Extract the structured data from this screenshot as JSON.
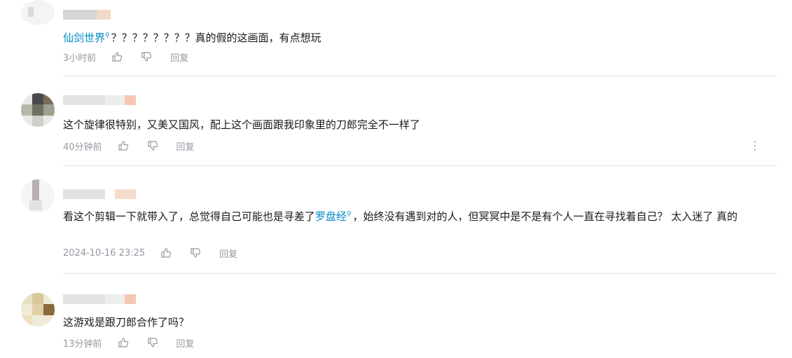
{
  "comments": [
    {
      "text_parts": {
        "keyword": "仙剑世界",
        "rest": "？？？？？？？？真的假的这画面，有点想玩"
      },
      "time": "3小时前",
      "reply_label": "回复"
    },
    {
      "text": "这个旋律很特别，又美又国风，配上这个画面跟我印象里的刀郎完全不一样了",
      "time": "40分钟前",
      "reply_label": "回复",
      "more_icon": "⋮"
    },
    {
      "text_parts": {
        "before": "看这个剪辑一下就带入了，总觉得自己可能也是寻差了",
        "keyword": "罗盘经",
        "after": "，始终没有遇到对的人，但冥冥中是不是有个人一直在寻找着自己？ 太入迷了 真的"
      },
      "time": "2024-10-16 23:25",
      "reply_label": "回复"
    },
    {
      "text": "这游戏是跟刀郎合作了吗？",
      "time": "13分钟前",
      "reply_label": "回复"
    }
  ],
  "colors": {
    "keyword": "#008ac5",
    "meta": "#9499a0",
    "divider": "#e3e5e7"
  },
  "icons": {
    "like": "thumbs-up-icon",
    "dislike": "thumbs-down-icon",
    "keyword": "search-icon",
    "more": "more-vertical-icon"
  }
}
